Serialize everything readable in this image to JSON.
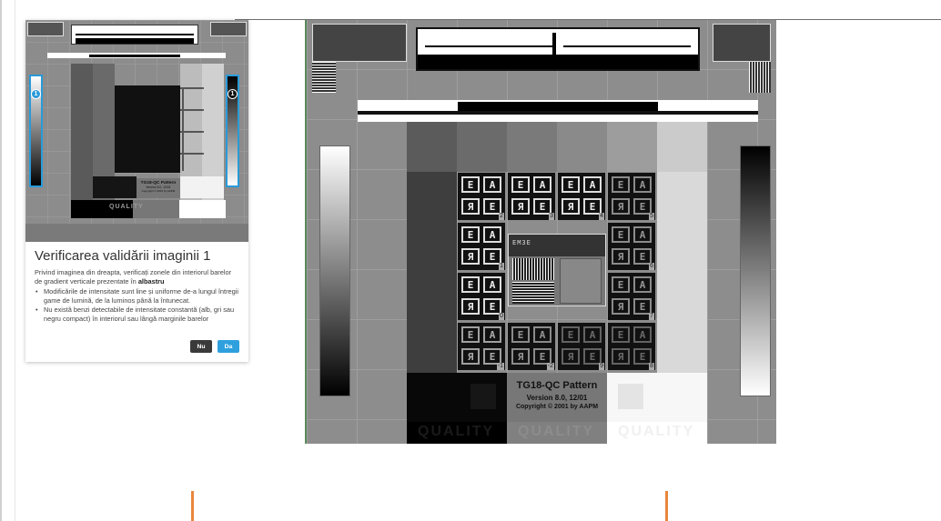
{
  "card": {
    "title": "Verificarea validării imaginii 1",
    "intro_prefix": "Privind imaginea din dreapta, verificați zonele din interiorul barelor de gradient verticale prezentate în ",
    "intro_bold": "albastru",
    "bullets": [
      "Modificările de intensitate sunt line și uniforme de-a lungul întregii game de lumină, de la luminos până la întunecat.",
      "Nu există benzi detectabile de intensitate constantă (alb, gri sau negru compact) în interiorul sau lângă marginile barelor"
    ],
    "btn_no": "Nu",
    "btn_yes": "Da"
  },
  "thumb": {
    "marker_left": "1",
    "marker_right": "1",
    "qc_title": "TG18-QC Pattern",
    "qc_version": "Version 8.0, 12/01",
    "qc_copyright": "Copyright © 2001 by AAPM",
    "quality": "QUALITY"
  },
  "main": {
    "qc_title": "TG18-QC Pattern",
    "qc_version": "Version 8.0, 12/01",
    "qc_copyright": "Copyright © 2001 by AAPM",
    "quality_labels": [
      "QUALITY",
      "QUALITY",
      "QUALITY"
    ],
    "tile_numbers": [
      "2",
      "3",
      "4",
      "5",
      "1",
      "6",
      "0",
      "7",
      "-1",
      "-2",
      "9",
      "8"
    ],
    "patch_text": "EM3E"
  },
  "colors": {
    "accent": "#2fa0de",
    "orange": "#e8873d"
  }
}
